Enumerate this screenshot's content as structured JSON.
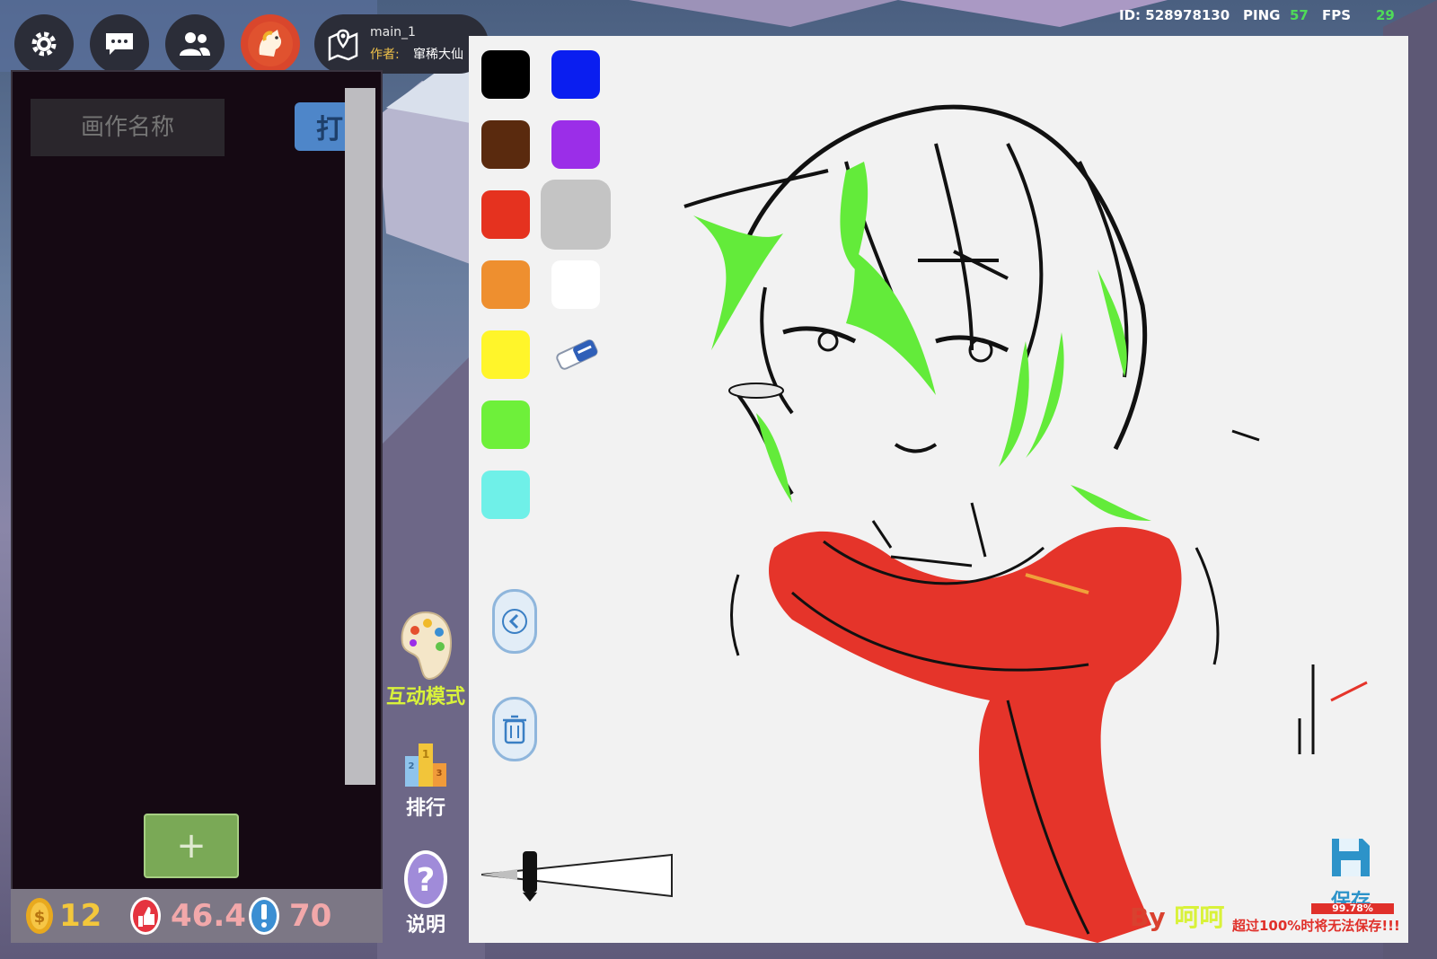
{
  "topbar": {
    "settings_icon": "gear-icon",
    "chat_icon": "chat-icon",
    "friends_icon": "people-icon",
    "avatar_icon": "horse-avatar-icon",
    "map": {
      "title": "main_1",
      "author_label": "作者:",
      "author": "窜稀大仙"
    }
  },
  "status": {
    "id_text": "ID: 528978130",
    "ping_label": "PING",
    "ping_value": "57",
    "fps_label": "FPS",
    "fps_value": "29"
  },
  "panel": {
    "name_placeholder": "画作名称",
    "open_label": "打",
    "add_label": "+"
  },
  "footer": {
    "coins": "12",
    "likes": "46.4",
    "alerts": "70"
  },
  "modes": {
    "interactive_label": "互动模式",
    "ranking_label": "排行",
    "help_label": "说明"
  },
  "palette": {
    "colors": [
      "#000000",
      "#0a1ef0",
      "#5a2a0e",
      "#9b2ee8",
      "#e5321f",
      "#c4c4c4",
      "#ee8f2f",
      "#ffffff",
      "#fff52a",
      "#6ef03a",
      "#6ff0e8"
    ],
    "eraser_icon": "eraser-icon",
    "back_icon": "chevron-left-icon",
    "trash_icon": "trash-icon"
  },
  "brush": {
    "size_slider_icon": "brush-size-slider"
  },
  "save": {
    "label": "保存",
    "percent_text": "99.78%",
    "percent": 99.78,
    "warning": "超过100%时将无法保存!!!"
  },
  "byline": {
    "by": "By",
    "author": "呵呵"
  }
}
